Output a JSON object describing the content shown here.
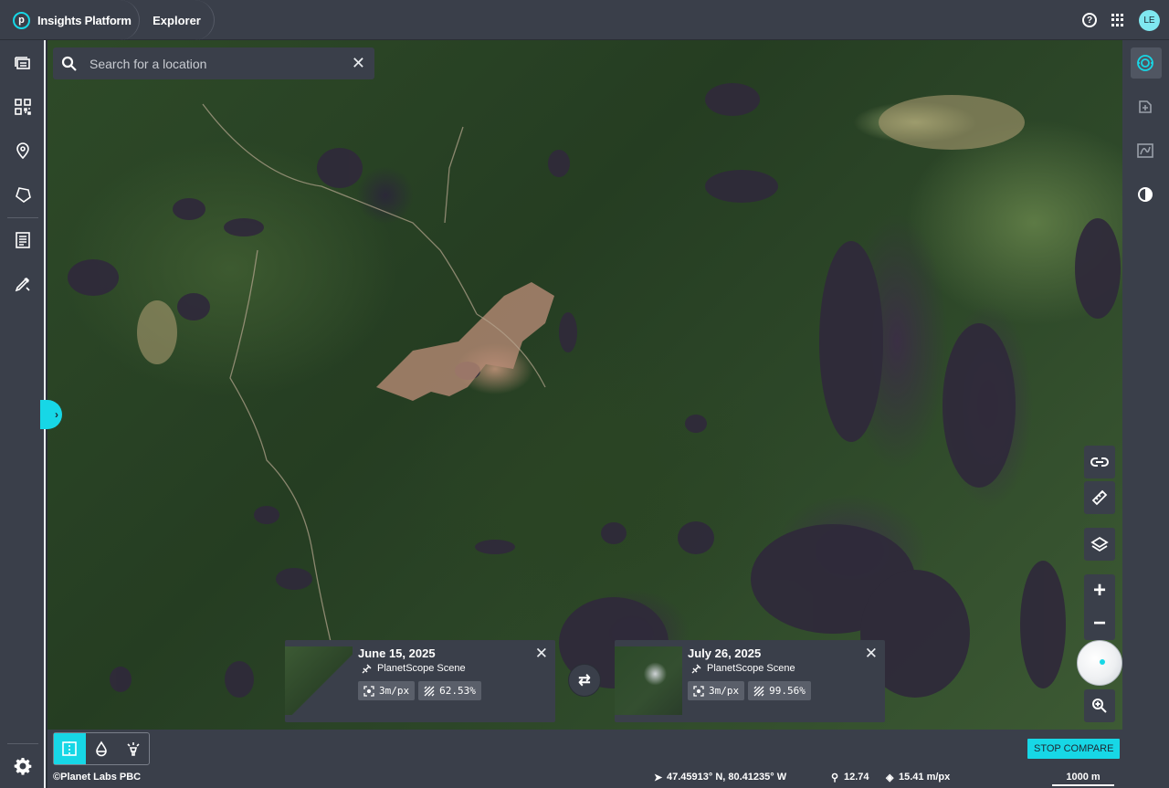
{
  "app": {
    "brand": "Insights Platform",
    "breadcrumb": "Explorer",
    "user_initials": "LE",
    "accent_color": "#17d7e6"
  },
  "search": {
    "placeholder": "Search for a location"
  },
  "left_sidebar": {
    "items": [
      {
        "icon": "layers-stack-icon"
      },
      {
        "icon": "qr-grid-icon"
      },
      {
        "icon": "map-pin-icon"
      },
      {
        "icon": "polygon-icon"
      },
      {
        "icon": "document-list-icon"
      },
      {
        "icon": "edit-draw-icon"
      }
    ],
    "footer_icon": "gear-icon"
  },
  "right_sidebar": {
    "items": [
      {
        "icon": "monitoring-icon",
        "active": true
      },
      {
        "icon": "add-analysis-icon"
      },
      {
        "icon": "timeline-chart-icon"
      },
      {
        "icon": "contrast-icon"
      }
    ]
  },
  "map_controls": [
    "link-icon",
    "ruler-icon",
    "layers-icon",
    "zoom-in-plus",
    "zoom-out-minus",
    "globe-overview",
    "zoom-area-icon"
  ],
  "compare": {
    "left": {
      "date": "June 15, 2025",
      "source": "PlanetScope Scene",
      "resolution": "3m/px",
      "coverage": "62.53%"
    },
    "right": {
      "date": "July 26, 2025",
      "source": "PlanetScope Scene",
      "resolution": "3m/px",
      "coverage": "99.56%"
    },
    "stop_label": "STOP COMPARE"
  },
  "status_bar": {
    "attribution": "©Planet Labs PBC",
    "coordinates": "47.45913° N, 80.41235° W",
    "zoom": "12.74",
    "pixel_size": "15.41 m/px",
    "scale": "1000 m"
  }
}
